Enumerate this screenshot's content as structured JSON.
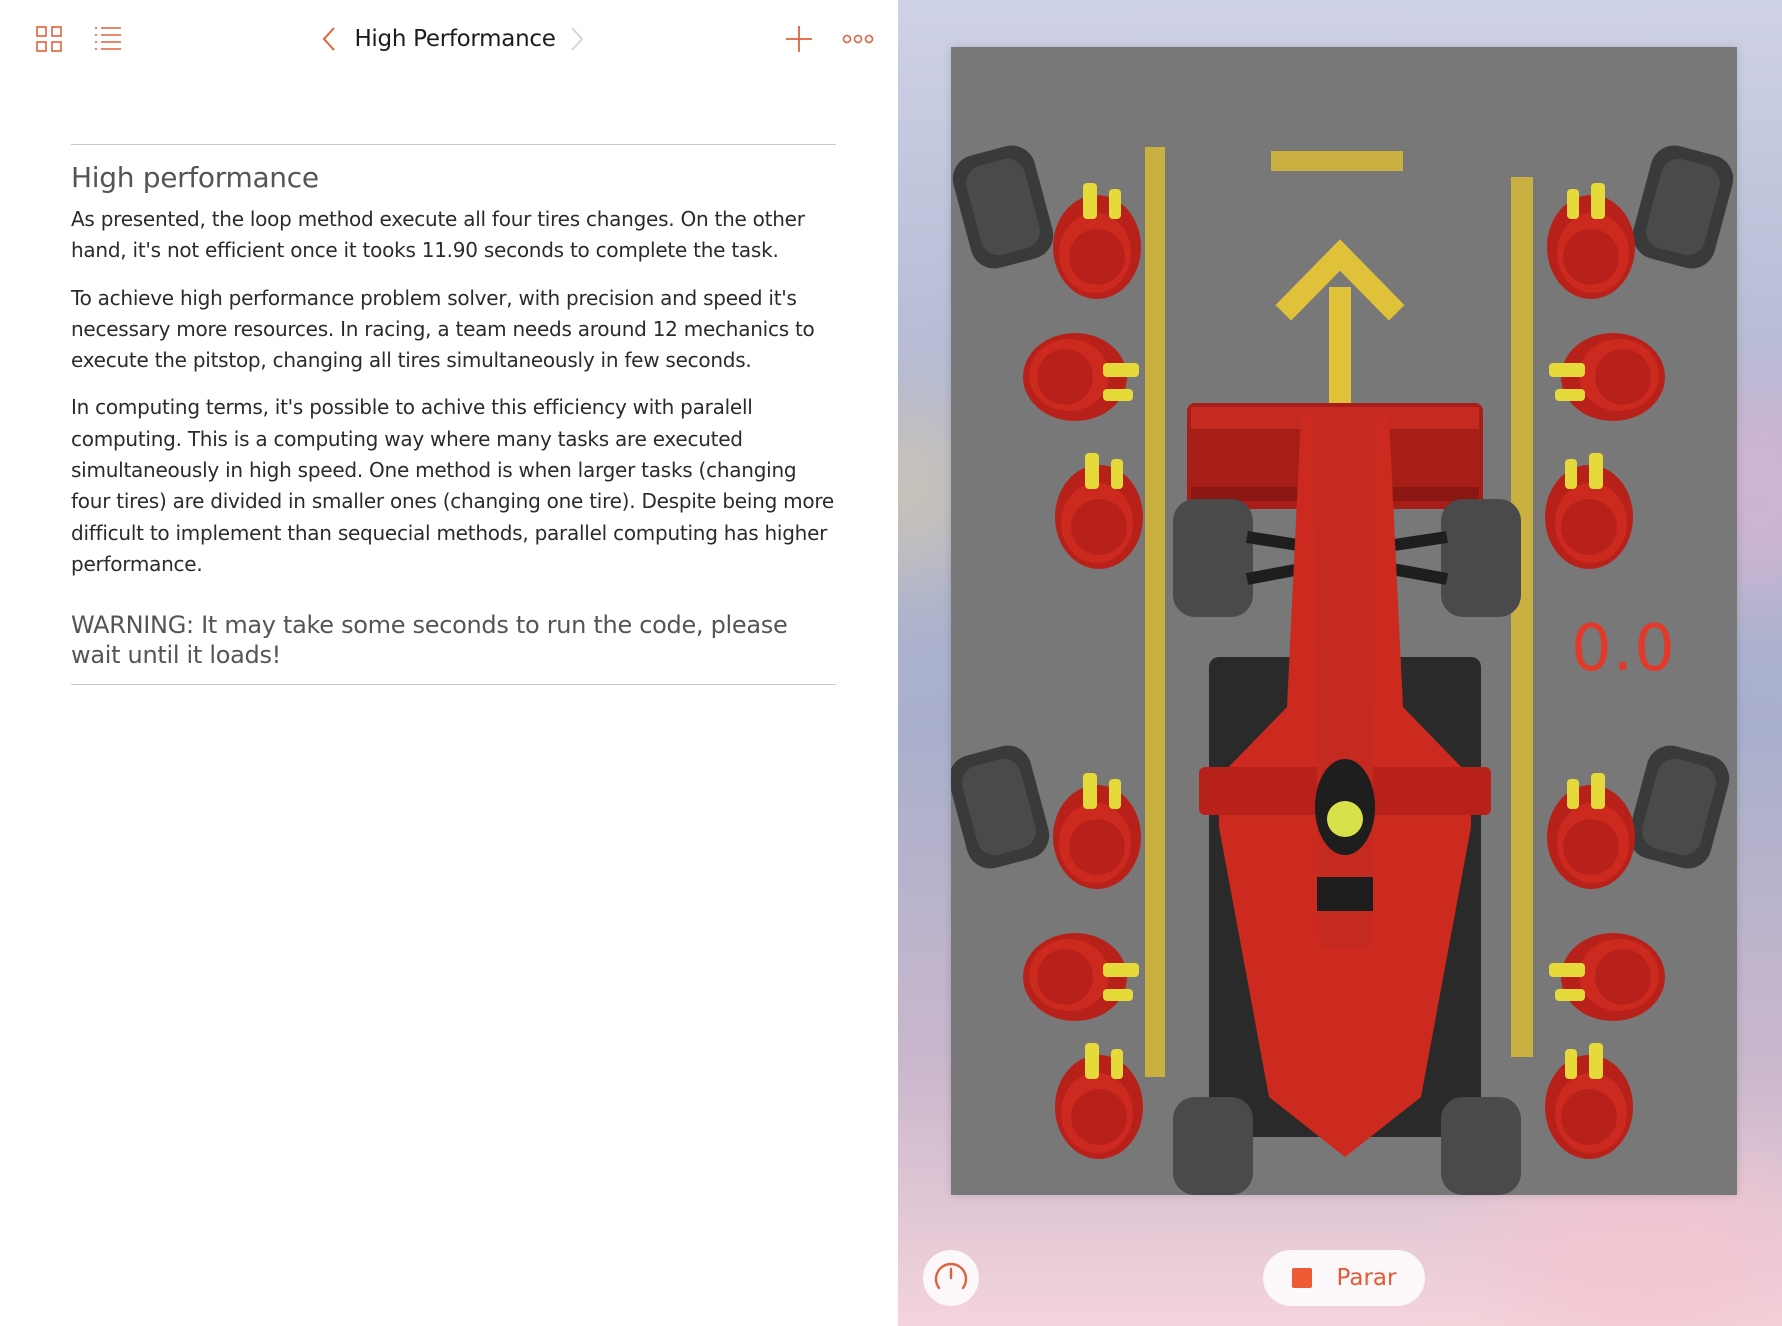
{
  "toolbar": {
    "title": "High Performance",
    "icons": {
      "grid": "grid-icon",
      "list": "list-icon",
      "back": "chevron-left-icon",
      "forward": "chevron-right-icon",
      "add": "plus-icon",
      "more": "more-icon"
    },
    "accent_color": "#e0623c"
  },
  "document": {
    "heading": "High performance",
    "paragraphs": [
      "As presented, the loop method execute all four tires changes. On the other hand, it's not efficient once it tooks 11.90 seconds to complete the task.",
      "To achieve high performance problem solver, with precision and speed it's necessary more resources. In racing, a team needs around 12 mechanics to execute the pitstop, changing all tires simultaneously in few seconds.",
      "In computing terms, it's possible to achive this efficiency with paralell computing. This is a computing way where many tasks are executed simultaneously in high speed. One method is when larger tasks (changing four tires) are divided in smaller ones (changing one tire). Despite being more difficult to implement than sequecial methods, parallel computing has higher performance."
    ],
    "warning": "WARNING: It may take some seconds to run the code, please wait until it loads!"
  },
  "live_view": {
    "timer": "0.0",
    "timer_color": "#e23a2a",
    "car_color": "#cc2a1e",
    "crew_color": "#c0201a",
    "line_color": "#e6c43a",
    "speed_icon": "speedometer-icon",
    "stop_label": "Parar",
    "stop_icon": "stop-square-icon"
  }
}
